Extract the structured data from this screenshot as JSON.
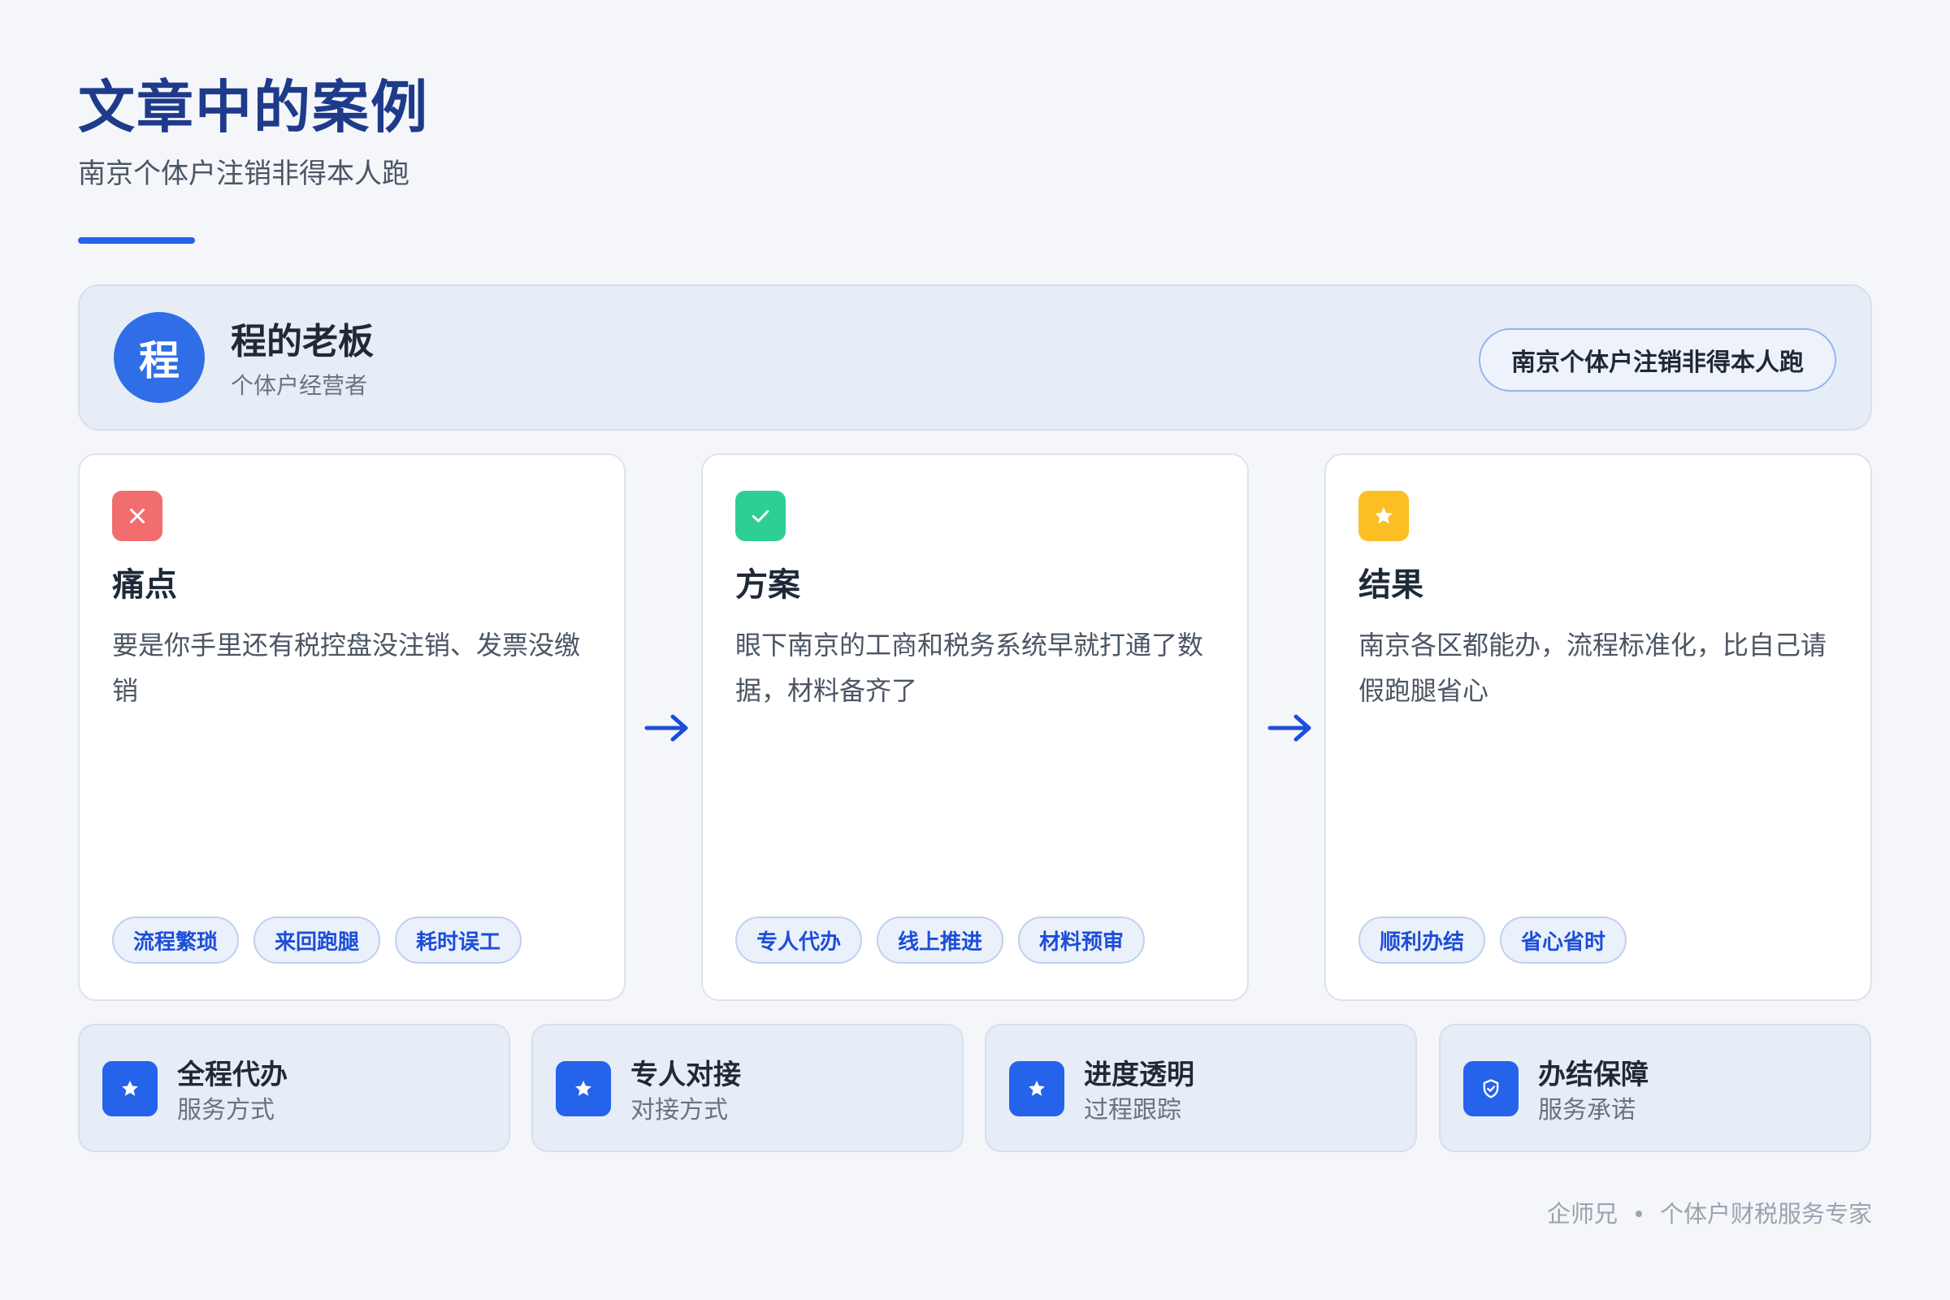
{
  "header": {
    "title": "文章中的案例",
    "subtitle": "南京个体户注销非得本人跑"
  },
  "author": {
    "avatar_char": "程",
    "name": "程的老板",
    "role": "个体户经营者",
    "badge": "南京个体户注销非得本人跑"
  },
  "cards": [
    {
      "icon": "close-icon",
      "icon_color": "#f26d6d",
      "title": "痛点",
      "text": "要是你手里还有税控盘没注销、发票没缴销",
      "tags": [
        "流程繁琐",
        "来回跑腿",
        "耗时误工"
      ]
    },
    {
      "icon": "check-icon",
      "icon_color": "#2ecf95",
      "title": "方案",
      "text": "眼下南京的工商和税务系统早就打通了数据，材料备齐了",
      "tags": [
        "专人代办",
        "线上推进",
        "材料预审"
      ]
    },
    {
      "icon": "star-icon",
      "icon_color": "#fbbf24",
      "title": "结果",
      "text": "南京各区都能办，流程标准化，比自己请假跑腿省心",
      "tags": [
        "顺利办结",
        "省心省时"
      ]
    }
  ],
  "features": [
    {
      "icon": "star-icon",
      "title": "全程代办",
      "subtitle": "服务方式"
    },
    {
      "icon": "star-icon",
      "title": "专人对接",
      "subtitle": "对接方式"
    },
    {
      "icon": "star-icon",
      "title": "进度透明",
      "subtitle": "过程跟踪"
    },
    {
      "icon": "shield-check-icon",
      "title": "办结保障",
      "subtitle": "服务承诺"
    }
  ],
  "footer": {
    "brand": "企师兄",
    "tagline": "个体户财税服务专家"
  },
  "colors": {
    "accent": "#2563eb",
    "title": "#1e3a8a",
    "arrow": "#1d4ed8"
  }
}
